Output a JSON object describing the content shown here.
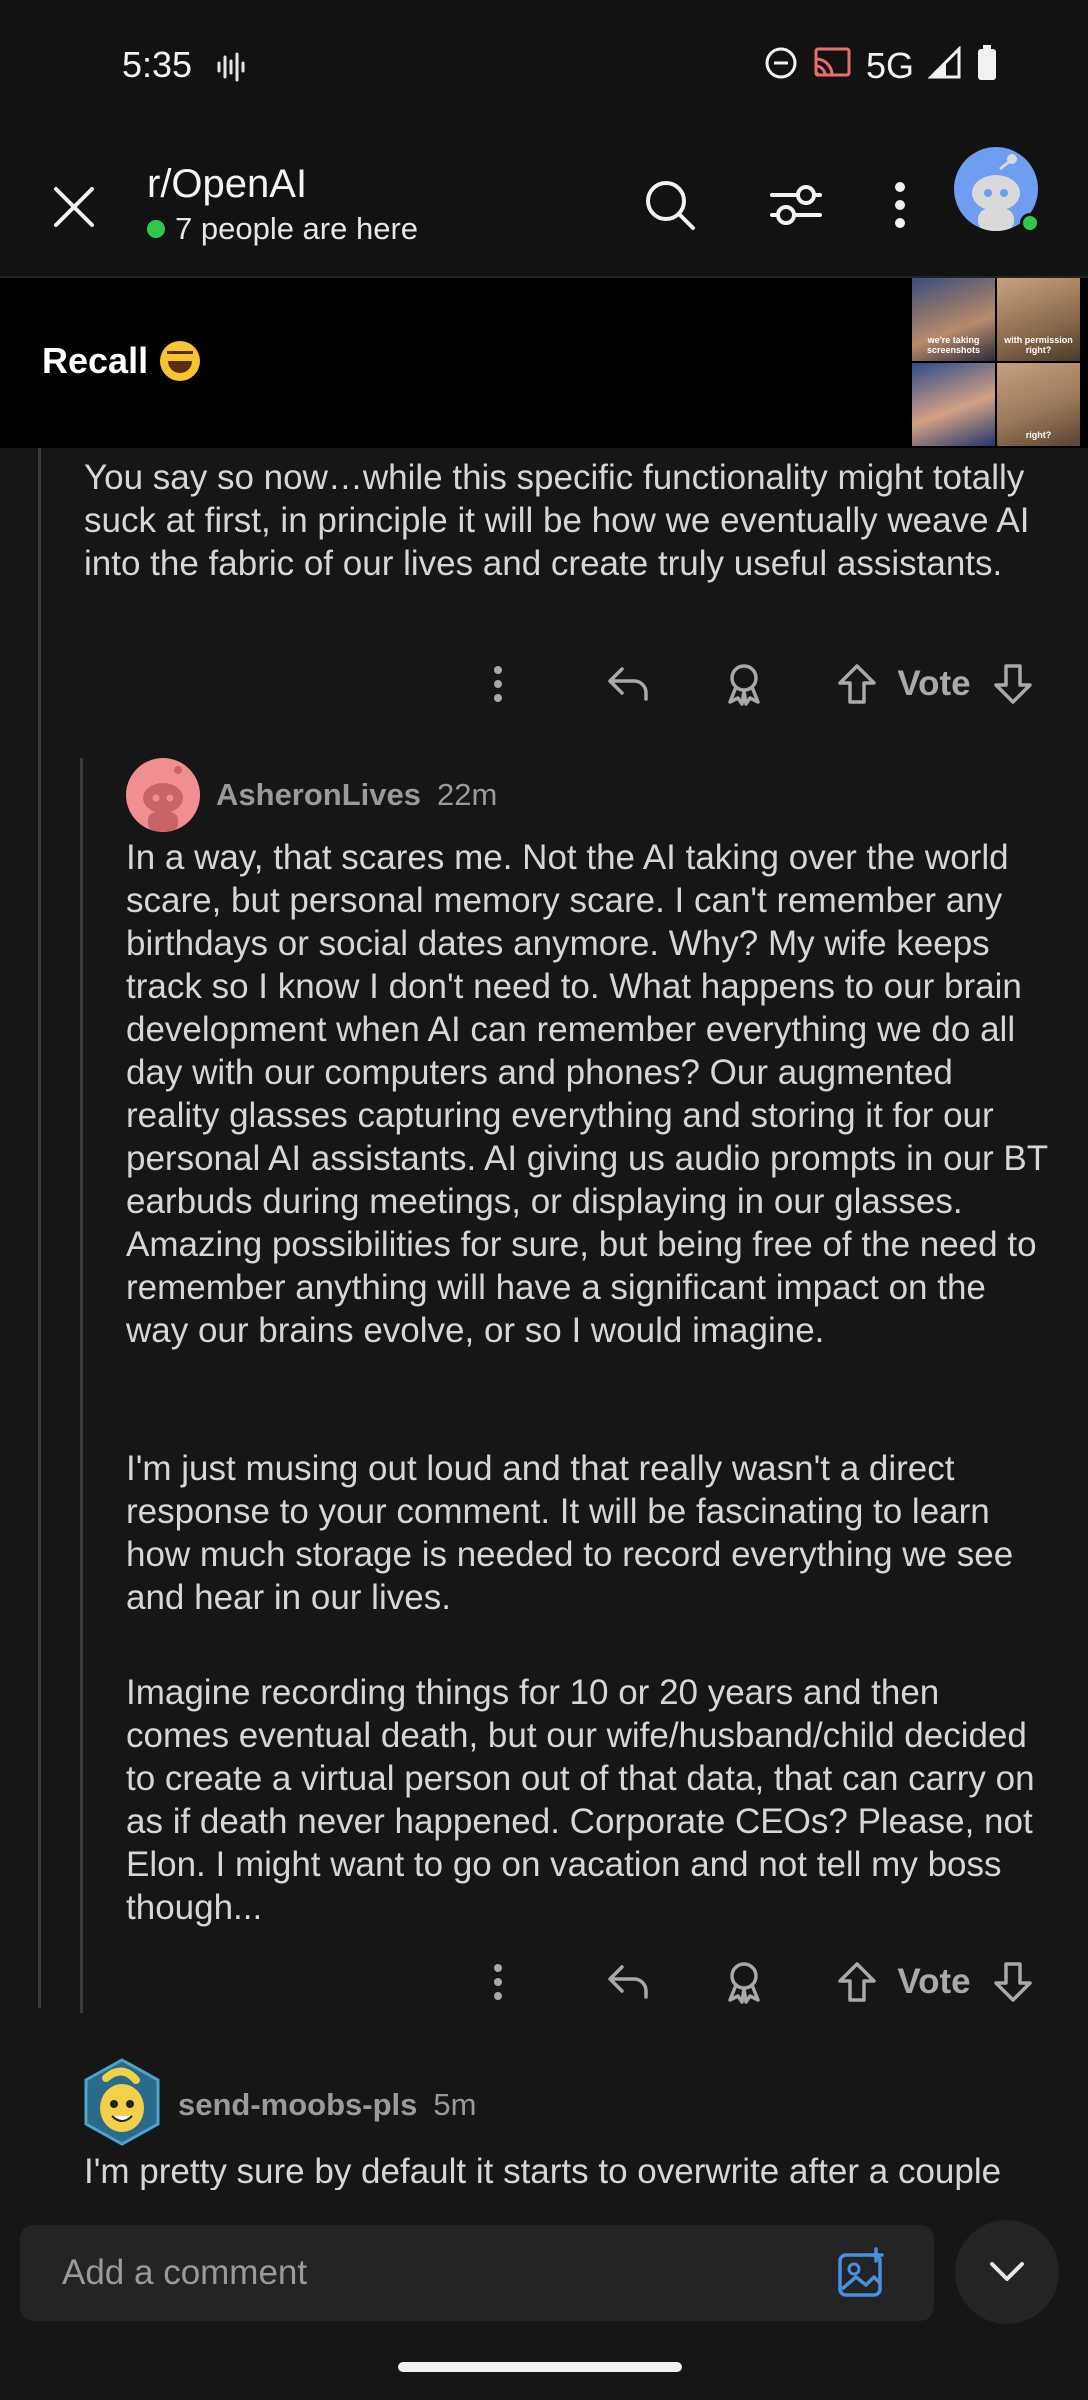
{
  "status_bar": {
    "time": "5:35",
    "network": "5G"
  },
  "header": {
    "subreddit": "r/OpenAI",
    "presence": "7 people are here",
    "icons": [
      "close-icon",
      "search-icon",
      "filter-icon",
      "more-vert-icon",
      "user-avatar"
    ]
  },
  "post": {
    "title": "Recall",
    "thumbnail_captions": [
      "we're taking screenshots",
      "with permission right?",
      "",
      "right?"
    ]
  },
  "comments": [
    {
      "text": "You say so now…while this specific functionality might totally suck at first, in principle it will be how we eventually weave AI into the fabric of our lives and create truly useful assistants.",
      "vote_label": "Vote"
    },
    {
      "author": "AsheronLives",
      "age": "22m",
      "paragraphs": [
        "In a way, that scares me.  Not the AI taking over the world scare, but personal memory scare.  I can't remember any birthdays or social dates anymore.  Why?  My wife keeps track so I know I don't need to.  What happens to our brain development when AI can remember everything we do all day with our computers and phones?  Our augmented reality glasses capturing everything and storing it for our personal AI assistants.  AI giving us audio prompts in our BT earbuds during meetings, or displaying in our glasses.  Amazing possibilities for sure, but being free of the need to remember anything will have a significant impact on the way our brains evolve, or so I would imagine.",
        "I'm just musing out loud and that really wasn't a direct response to your comment.  It will be fascinating to learn how much storage is needed to record everything we see and hear in our lives.",
        "Imagine recording things for 10 or 20 years and then comes eventual death, but our wife/husband/child decided to create a virtual person out of that data, that can carry on as if death never happened.  Corporate CEOs?  Please, not Elon.  I might want to go on vacation and not tell my boss though..."
      ],
      "vote_label": "Vote"
    },
    {
      "author": "send-moobs-pls",
      "age": "5m",
      "text": "I'm pretty sure by default it starts to overwrite after a couple months. It is optional though. I can imagine using"
    }
  ],
  "composer": {
    "placeholder": "Add a comment"
  },
  "colors": {
    "background": "#161616",
    "online": "#2ec94c",
    "accent": "#4a90e2"
  }
}
